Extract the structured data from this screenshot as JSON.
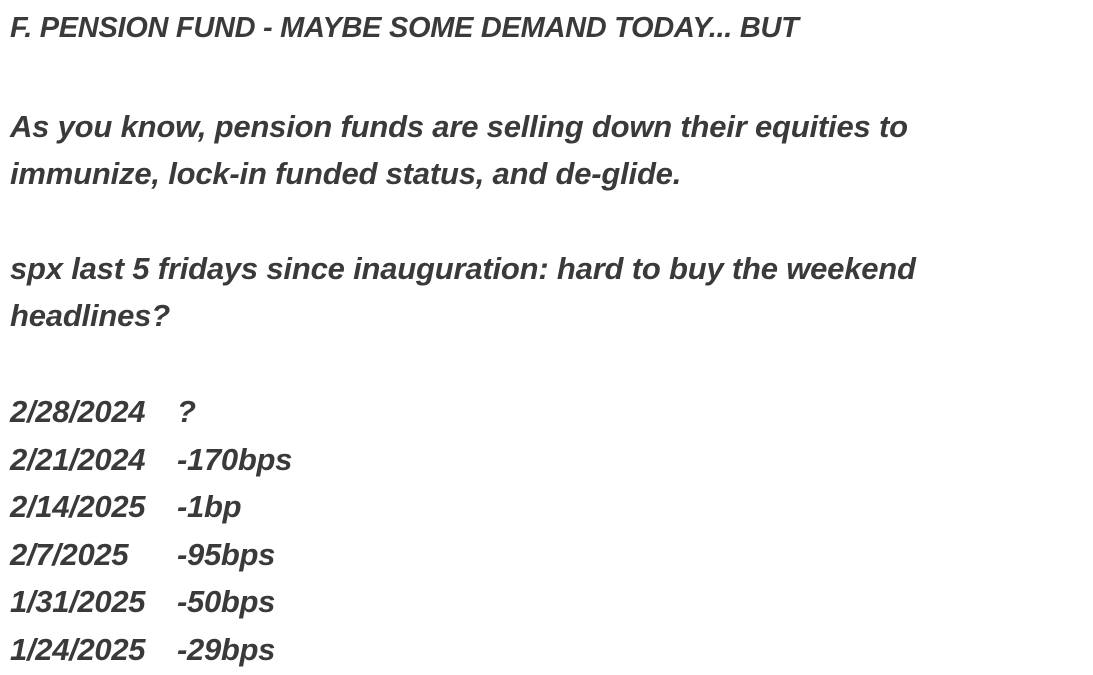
{
  "heading": "F. PENSION FUND - MAYBE SOME DEMAND TODAY... BUT",
  "paragraph1": {
    "line1": "As you know, pension funds are selling down their equities to",
    "line2": "immunize, lock-in funded status, and de-glide."
  },
  "paragraph2": {
    "line1": "spx last 5 fridays since inauguration: hard to buy the weekend",
    "line2": "headlines?"
  },
  "rows": [
    {
      "date": "2/28/2024",
      "value": "?"
    },
    {
      "date": "2/21/2024",
      "value": "-170bps"
    },
    {
      "date": "2/14/2025",
      "value": "-1bp"
    },
    {
      "date": "2/7/2025",
      "value": "-95bps"
    },
    {
      "date": "1/31/2025",
      "value": "-50bps"
    },
    {
      "date": "1/24/2025",
      "value": "-29bps"
    }
  ]
}
